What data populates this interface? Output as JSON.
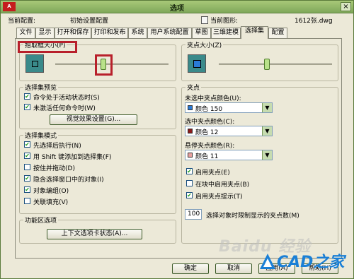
{
  "titlebar": {
    "title": "选项",
    "app_icon": "A",
    "close": "×"
  },
  "config": {
    "current_config_label": "当前配置:",
    "current_config_value": "初始设置配置",
    "current_drawing_label": "当前图形:",
    "current_drawing_value": "1612张.dwg"
  },
  "tabs": [
    "文件",
    "显示",
    "打开和保存",
    "打印和发布",
    "系统",
    "用户系统配置",
    "草图",
    "三维建模",
    "选择集",
    "配置"
  ],
  "left": {
    "pickbox": {
      "title": "拾取框大小(P)",
      "level": 0.42
    },
    "preview": {
      "title": "选择集预览",
      "items": [
        {
          "label": "命令处于活动状态时(S)",
          "checked": "✔"
        },
        {
          "label": "未激活任何命令时(W)",
          "checked": "✔"
        }
      ],
      "button": "视觉效果设置(G)..."
    },
    "modes": {
      "title": "选择集模式",
      "items": [
        {
          "label": "先选择后执行(N)",
          "checked": "✔"
        },
        {
          "label": "用 Shift 键添加到选择集(F)",
          "checked": "✔"
        },
        {
          "label": "按住并拖动(D)",
          "checked": ""
        },
        {
          "label": "隐含选择窗口中的对象(I)",
          "checked": "✔"
        },
        {
          "label": "对象编组(O)",
          "checked": "✔"
        },
        {
          "label": "关联填充(V)",
          "checked": ""
        }
      ]
    },
    "ribbon": {
      "title": "功能区选项",
      "button": "上下文选项卡状态(A)..."
    }
  },
  "right": {
    "gripsize": {
      "title": "夹点大小(Z)",
      "level": 0.42
    },
    "grips": {
      "title": "夹点",
      "unselected_label": "未选中夹点颜色(U):",
      "unselected_value": "颜色 150",
      "unselected_color": "#2a7ad6",
      "selected_label": "选中夹点颜色(C):",
      "selected_value": "颜色 12",
      "selected_color": "#8a1a1a",
      "hover_label": "悬停夹点颜色(R):",
      "hover_value": "颜色 11",
      "hover_color": "#e8a0a0",
      "checks": [
        {
          "label": "启用夹点(E)",
          "checked": "✔"
        },
        {
          "label": "在块中启用夹点(B)",
          "checked": ""
        },
        {
          "label": "启用夹点提示(T)",
          "checked": "✔"
        }
      ],
      "limit_value": "100",
      "limit_label": "选择对象时限制显示的夹点数(M)"
    }
  },
  "footer": {
    "ok": "确定",
    "cancel": "取消",
    "apply": "应用(A)",
    "help": "帮助(H)"
  },
  "watermark": {
    "baidu": "Baidu 经验",
    "cad": "CAD之家"
  }
}
